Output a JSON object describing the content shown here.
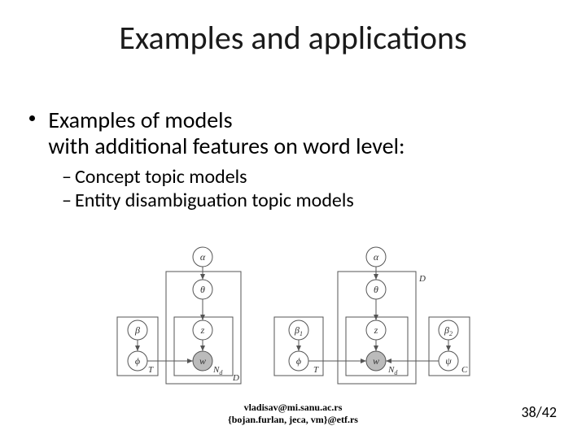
{
  "title": "Examples and applications",
  "bullet_line1": "Examples of models",
  "bullet_line2": "with additional features on word level:",
  "sub1": "Concept topic models",
  "sub2": "Entity disambiguation topic models",
  "diagram_left": {
    "alpha": "α",
    "theta": "θ",
    "beta": "β",
    "phi": "ϕ",
    "z": "z",
    "w": "w",
    "T": "T",
    "Nd": "N",
    "Nd_sub": "d",
    "D": "D"
  },
  "diagram_right": {
    "alpha": "α",
    "theta": "θ",
    "beta1": "β",
    "beta1_sub": "1",
    "phi": "ϕ",
    "z": "z",
    "w": "w",
    "beta2": "β",
    "beta2_sub": "2",
    "psi": "ψ",
    "T": "T",
    "Nd": "N",
    "Nd_sub": "d",
    "D": "D",
    "C": "C"
  },
  "footer": {
    "email1": "vladisav@mi.sanu.ac.rs",
    "email2": "{bojan.furlan, jeca, vm}@etf.rs"
  },
  "page_indicator": "38/42"
}
